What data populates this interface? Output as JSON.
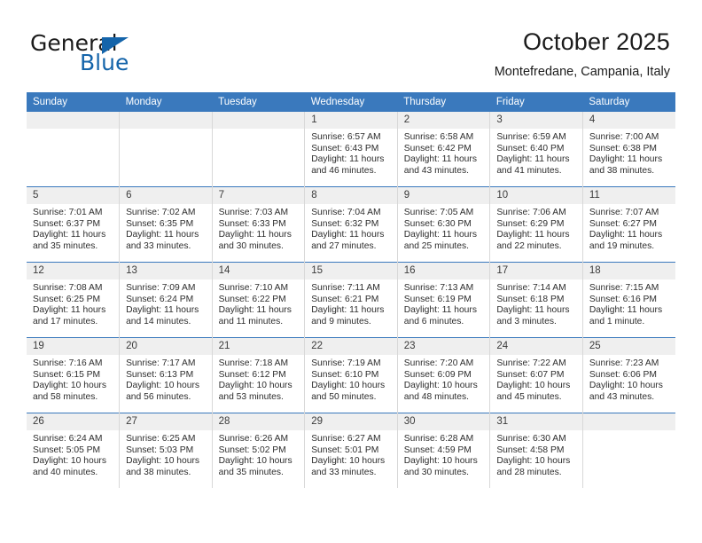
{
  "brand": {
    "word1": "General",
    "word2": "Blue",
    "accent_color": "#1464aa"
  },
  "header": {
    "title": "October 2025",
    "location": "Montefredane, Campania, Italy"
  },
  "calendar": {
    "header_bg": "#3a79bd",
    "daynum_bg": "#efefef",
    "weekday_names": [
      "Sunday",
      "Monday",
      "Tuesday",
      "Wednesday",
      "Thursday",
      "Friday",
      "Saturday"
    ],
    "labels": {
      "sunrise": "Sunrise:",
      "sunset": "Sunset:",
      "daylight": "Daylight:"
    },
    "weeks": [
      [
        {
          "day": "",
          "empty": true
        },
        {
          "day": "",
          "empty": true
        },
        {
          "day": "",
          "empty": true
        },
        {
          "day": "1",
          "sunrise": "Sunrise: 6:57 AM",
          "sunset": "Sunset: 6:43 PM",
          "daylight": "Daylight: 11 hours and 46 minutes."
        },
        {
          "day": "2",
          "sunrise": "Sunrise: 6:58 AM",
          "sunset": "Sunset: 6:42 PM",
          "daylight": "Daylight: 11 hours and 43 minutes."
        },
        {
          "day": "3",
          "sunrise": "Sunrise: 6:59 AM",
          "sunset": "Sunset: 6:40 PM",
          "daylight": "Daylight: 11 hours and 41 minutes."
        },
        {
          "day": "4",
          "sunrise": "Sunrise: 7:00 AM",
          "sunset": "Sunset: 6:38 PM",
          "daylight": "Daylight: 11 hours and 38 minutes."
        }
      ],
      [
        {
          "day": "5",
          "sunrise": "Sunrise: 7:01 AM",
          "sunset": "Sunset: 6:37 PM",
          "daylight": "Daylight: 11 hours and 35 minutes."
        },
        {
          "day": "6",
          "sunrise": "Sunrise: 7:02 AM",
          "sunset": "Sunset: 6:35 PM",
          "daylight": "Daylight: 11 hours and 33 minutes."
        },
        {
          "day": "7",
          "sunrise": "Sunrise: 7:03 AM",
          "sunset": "Sunset: 6:33 PM",
          "daylight": "Daylight: 11 hours and 30 minutes."
        },
        {
          "day": "8",
          "sunrise": "Sunrise: 7:04 AM",
          "sunset": "Sunset: 6:32 PM",
          "daylight": "Daylight: 11 hours and 27 minutes."
        },
        {
          "day": "9",
          "sunrise": "Sunrise: 7:05 AM",
          "sunset": "Sunset: 6:30 PM",
          "daylight": "Daylight: 11 hours and 25 minutes."
        },
        {
          "day": "10",
          "sunrise": "Sunrise: 7:06 AM",
          "sunset": "Sunset: 6:29 PM",
          "daylight": "Daylight: 11 hours and 22 minutes."
        },
        {
          "day": "11",
          "sunrise": "Sunrise: 7:07 AM",
          "sunset": "Sunset: 6:27 PM",
          "daylight": "Daylight: 11 hours and 19 minutes."
        }
      ],
      [
        {
          "day": "12",
          "sunrise": "Sunrise: 7:08 AM",
          "sunset": "Sunset: 6:25 PM",
          "daylight": "Daylight: 11 hours and 17 minutes."
        },
        {
          "day": "13",
          "sunrise": "Sunrise: 7:09 AM",
          "sunset": "Sunset: 6:24 PM",
          "daylight": "Daylight: 11 hours and 14 minutes."
        },
        {
          "day": "14",
          "sunrise": "Sunrise: 7:10 AM",
          "sunset": "Sunset: 6:22 PM",
          "daylight": "Daylight: 11 hours and 11 minutes."
        },
        {
          "day": "15",
          "sunrise": "Sunrise: 7:11 AM",
          "sunset": "Sunset: 6:21 PM",
          "daylight": "Daylight: 11 hours and 9 minutes."
        },
        {
          "day": "16",
          "sunrise": "Sunrise: 7:13 AM",
          "sunset": "Sunset: 6:19 PM",
          "daylight": "Daylight: 11 hours and 6 minutes."
        },
        {
          "day": "17",
          "sunrise": "Sunrise: 7:14 AM",
          "sunset": "Sunset: 6:18 PM",
          "daylight": "Daylight: 11 hours and 3 minutes."
        },
        {
          "day": "18",
          "sunrise": "Sunrise: 7:15 AM",
          "sunset": "Sunset: 6:16 PM",
          "daylight": "Daylight: 11 hours and 1 minute."
        }
      ],
      [
        {
          "day": "19",
          "sunrise": "Sunrise: 7:16 AM",
          "sunset": "Sunset: 6:15 PM",
          "daylight": "Daylight: 10 hours and 58 minutes."
        },
        {
          "day": "20",
          "sunrise": "Sunrise: 7:17 AM",
          "sunset": "Sunset: 6:13 PM",
          "daylight": "Daylight: 10 hours and 56 minutes."
        },
        {
          "day": "21",
          "sunrise": "Sunrise: 7:18 AM",
          "sunset": "Sunset: 6:12 PM",
          "daylight": "Daylight: 10 hours and 53 minutes."
        },
        {
          "day": "22",
          "sunrise": "Sunrise: 7:19 AM",
          "sunset": "Sunset: 6:10 PM",
          "daylight": "Daylight: 10 hours and 50 minutes."
        },
        {
          "day": "23",
          "sunrise": "Sunrise: 7:20 AM",
          "sunset": "Sunset: 6:09 PM",
          "daylight": "Daylight: 10 hours and 48 minutes."
        },
        {
          "day": "24",
          "sunrise": "Sunrise: 7:22 AM",
          "sunset": "Sunset: 6:07 PM",
          "daylight": "Daylight: 10 hours and 45 minutes."
        },
        {
          "day": "25",
          "sunrise": "Sunrise: 7:23 AM",
          "sunset": "Sunset: 6:06 PM",
          "daylight": "Daylight: 10 hours and 43 minutes."
        }
      ],
      [
        {
          "day": "26",
          "sunrise": "Sunrise: 6:24 AM",
          "sunset": "Sunset: 5:05 PM",
          "daylight": "Daylight: 10 hours and 40 minutes."
        },
        {
          "day": "27",
          "sunrise": "Sunrise: 6:25 AM",
          "sunset": "Sunset: 5:03 PM",
          "daylight": "Daylight: 10 hours and 38 minutes."
        },
        {
          "day": "28",
          "sunrise": "Sunrise: 6:26 AM",
          "sunset": "Sunset: 5:02 PM",
          "daylight": "Daylight: 10 hours and 35 minutes."
        },
        {
          "day": "29",
          "sunrise": "Sunrise: 6:27 AM",
          "sunset": "Sunset: 5:01 PM",
          "daylight": "Daylight: 10 hours and 33 minutes."
        },
        {
          "day": "30",
          "sunrise": "Sunrise: 6:28 AM",
          "sunset": "Sunset: 4:59 PM",
          "daylight": "Daylight: 10 hours and 30 minutes."
        },
        {
          "day": "31",
          "sunrise": "Sunrise: 6:30 AM",
          "sunset": "Sunset: 4:58 PM",
          "daylight": "Daylight: 10 hours and 28 minutes."
        },
        {
          "day": "",
          "empty": true
        }
      ]
    ]
  }
}
